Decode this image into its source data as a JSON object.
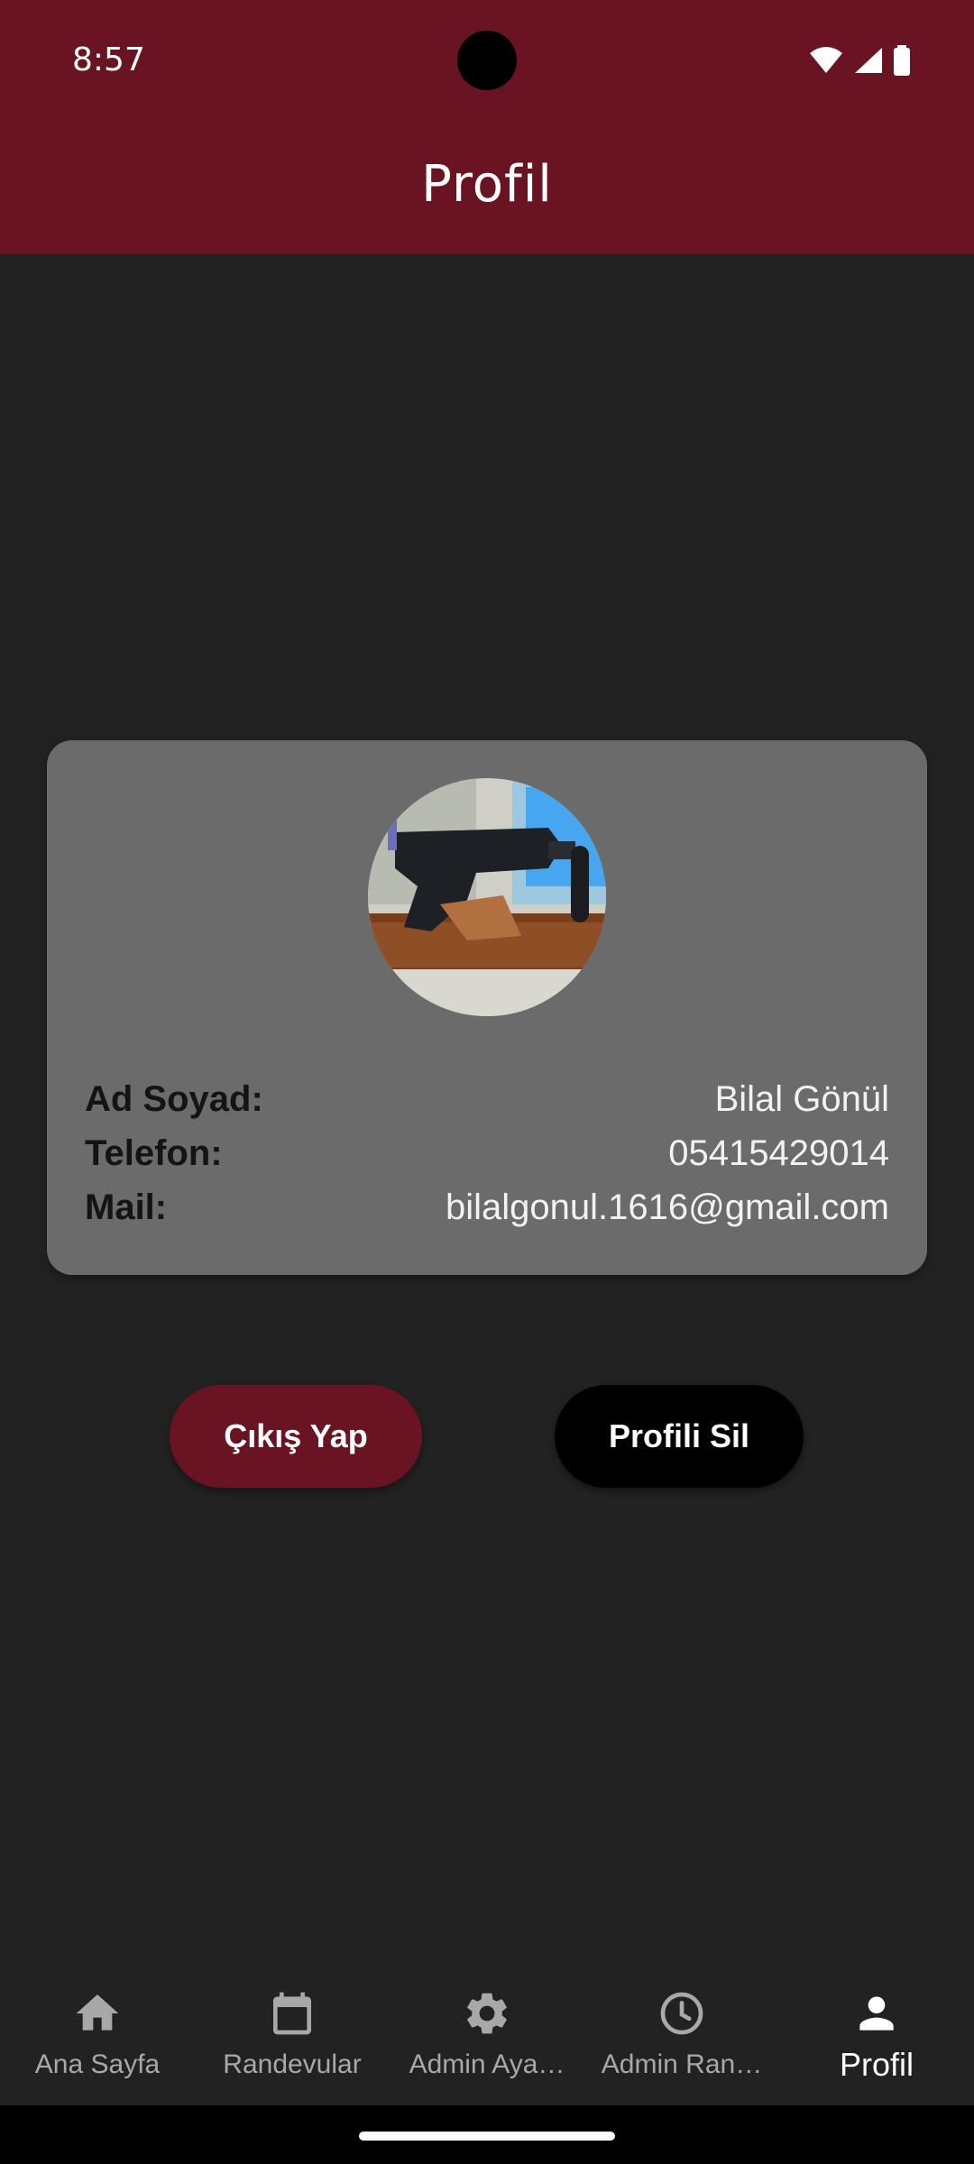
{
  "status_bar": {
    "time": "8:57"
  },
  "app_bar": {
    "title": "Profil"
  },
  "profile": {
    "labels": {
      "name": "Ad Soyad:",
      "phone": "Telefon:",
      "mail": "Mail:"
    },
    "values": {
      "name": "Bilal Gönül",
      "phone": "05415429014",
      "mail": "bilalgonul.1616@gmail.com"
    }
  },
  "actions": {
    "logout_label": "Çıkış Yap",
    "delete_label": "Profili Sil"
  },
  "nav": {
    "items": [
      {
        "label": "Ana Sayfa",
        "icon": "home-icon"
      },
      {
        "label": "Randevular",
        "icon": "calendar-icon"
      },
      {
        "label": "Admin Aya…",
        "icon": "gear-icon"
      },
      {
        "label": "Admin Ran…",
        "icon": "clock-icon"
      },
      {
        "label": "Profil",
        "icon": "person-icon",
        "active": true
      }
    ]
  },
  "colors": {
    "accent": "#6A1323",
    "background": "#222222",
    "card": "#6b6b6b"
  }
}
